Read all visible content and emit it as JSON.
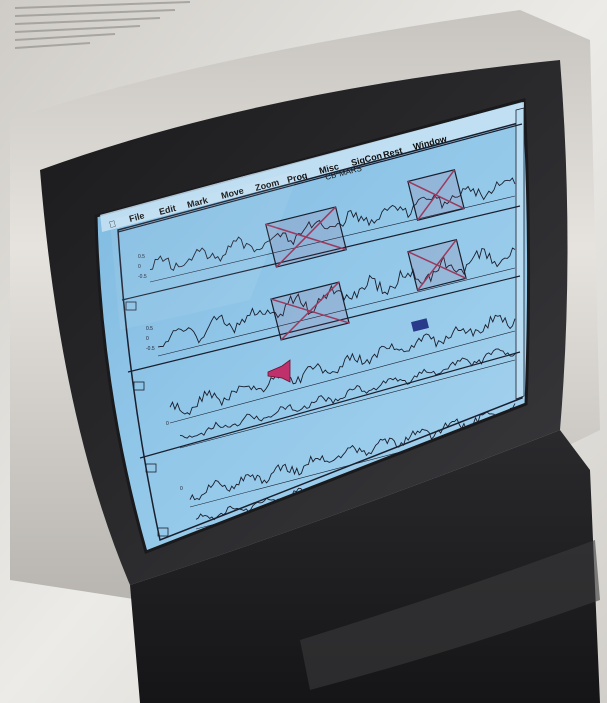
{
  "scene": {
    "description_colors": {
      "screen_background": "#8fc4e6",
      "trace_color": "#1a1f2e",
      "selection_box_color": "#9a3a5e",
      "marker_color": "#c0306a",
      "bezel_color": "#242426",
      "housing_color": "#d9d6d0"
    }
  },
  "app": {
    "window_title": "CB*MARS",
    "menu": [
      "File",
      "Edit",
      "Mark",
      "Move",
      "Zoom",
      "Prog",
      "Misc",
      "SigCon",
      "Rest",
      "Window"
    ]
  },
  "panels": [
    {
      "name": "trace-row-1",
      "tick_labels": [
        "0.5",
        "0",
        "-0.5"
      ]
    },
    {
      "name": "trace-row-2",
      "tick_labels": [
        "0.5",
        "0",
        "-0.5"
      ]
    },
    {
      "name": "trace-row-3",
      "tick_labels": [
        "0"
      ]
    },
    {
      "name": "trace-row-4",
      "tick_labels": [
        "0"
      ]
    }
  ],
  "icons": {
    "apple": "apple-menu-icon",
    "speaker": "speaker-marker-icon",
    "cursor": "selection-cursor-icon"
  }
}
